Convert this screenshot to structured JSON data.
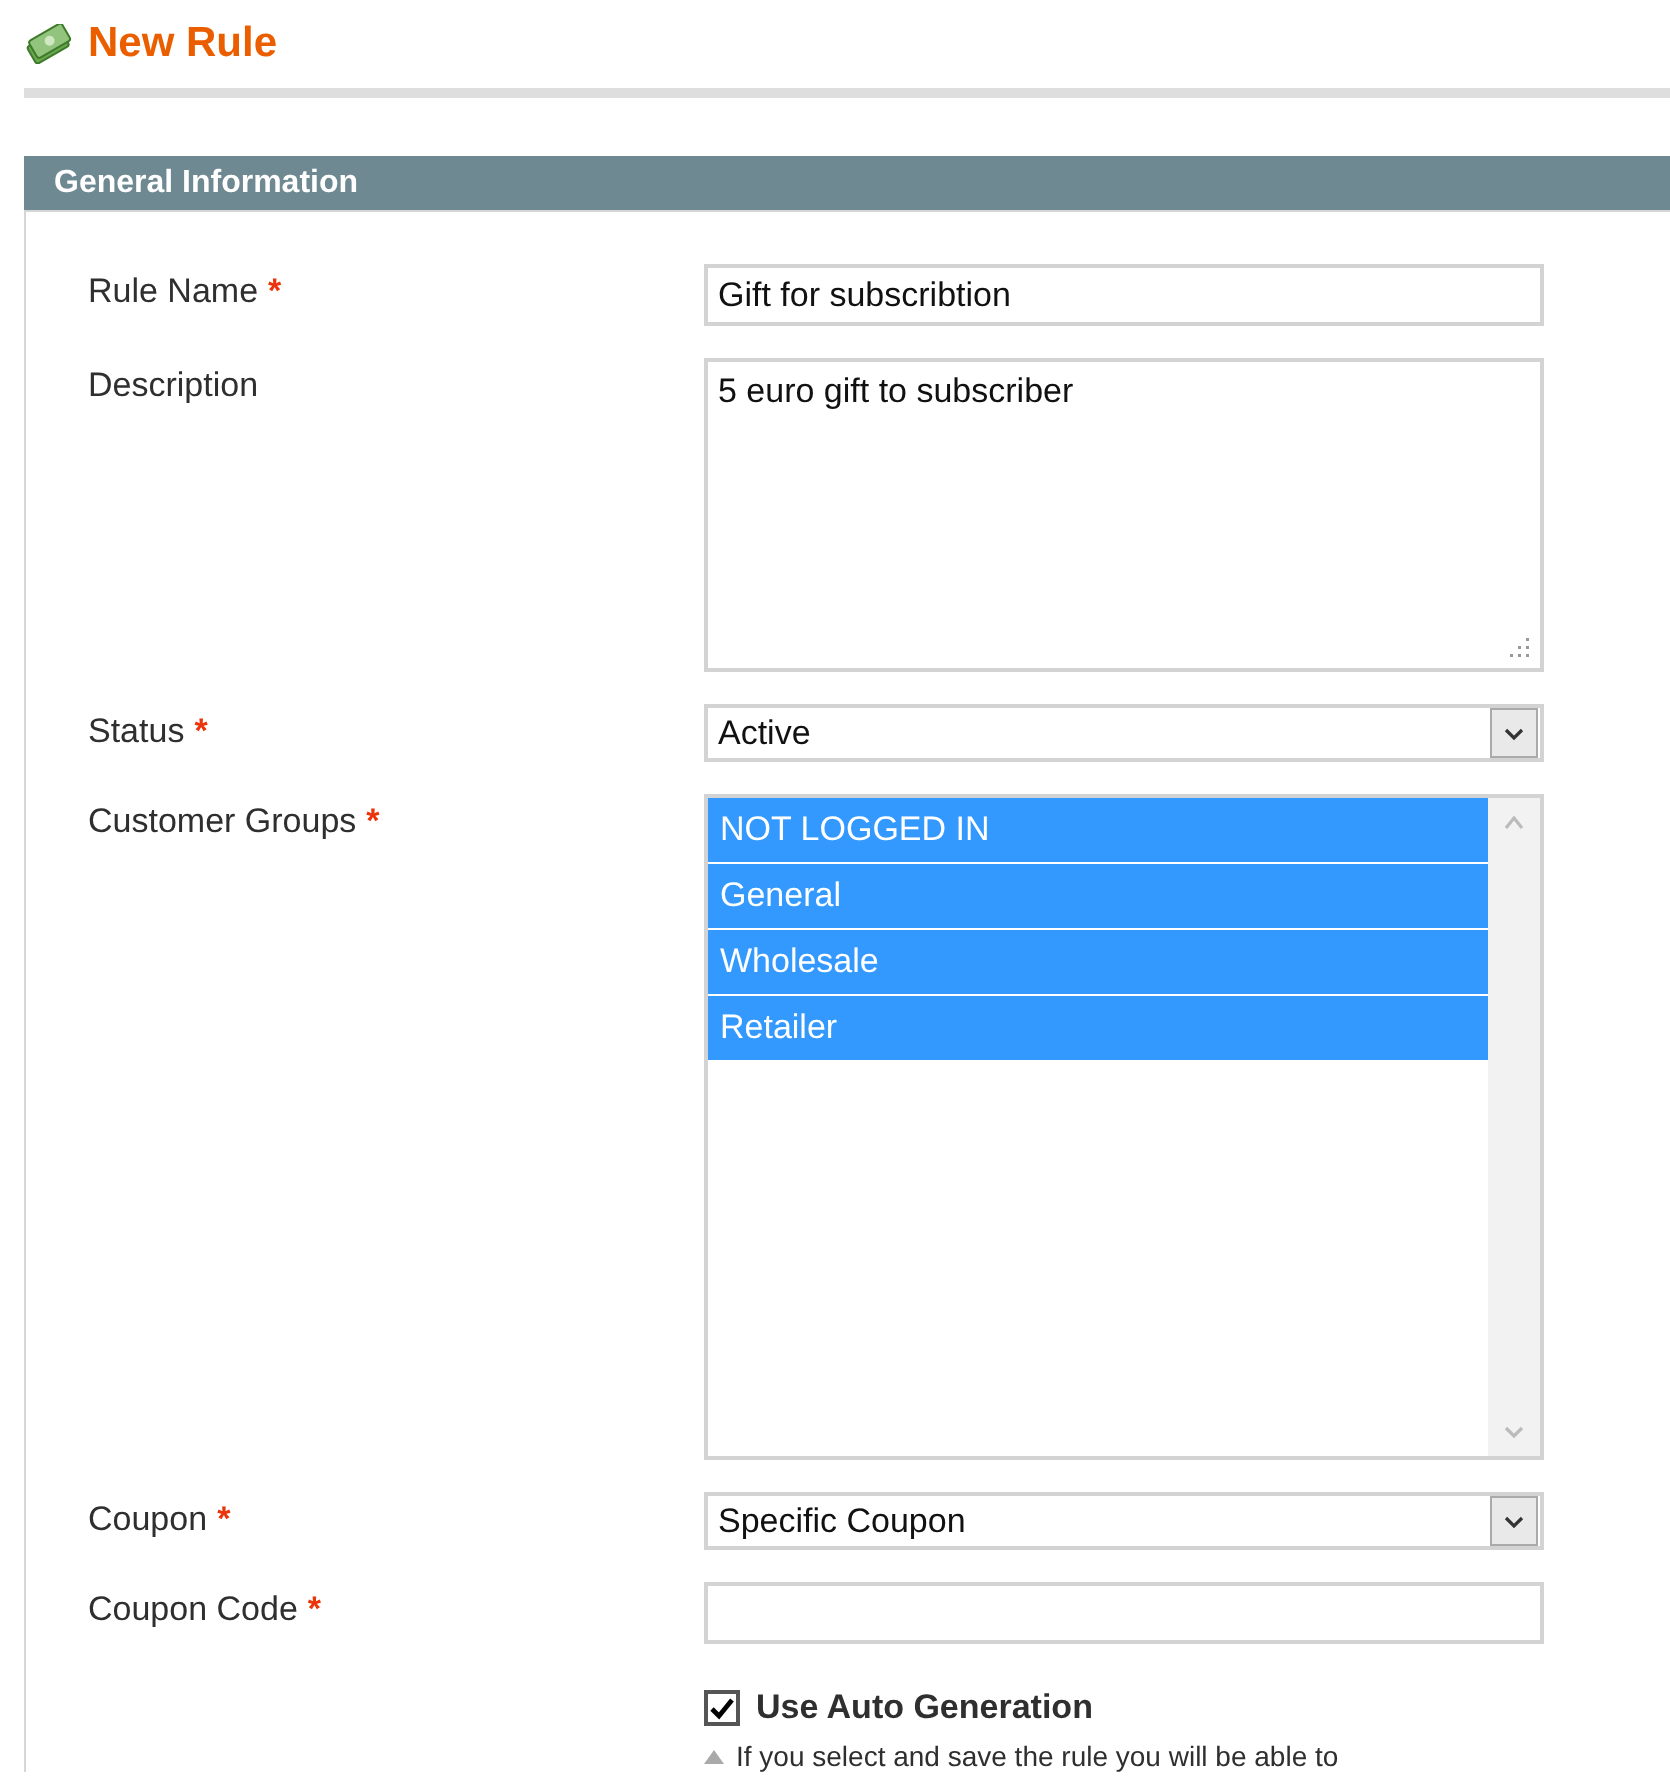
{
  "page": {
    "title": "New Rule"
  },
  "panel": {
    "title": "General Information",
    "fields": [
      {
        "kind": "text",
        "label": "Rule Name",
        "required_mark": "*",
        "value": "Gift for subscribtion"
      },
      {
        "kind": "textarea",
        "label": "Description",
        "value": "5 euro gift to subscriber"
      },
      {
        "kind": "select",
        "label": "Status",
        "required_mark": "*",
        "value": "Active"
      },
      {
        "kind": "multiselect",
        "label": "Customer Groups",
        "required_mark": "*",
        "options": [
          {
            "label": "NOT LOGGED IN",
            "selected": true
          },
          {
            "label": "General",
            "selected": true
          },
          {
            "label": "Wholesale",
            "selected": true
          },
          {
            "label": "Retailer",
            "selected": true
          }
        ]
      },
      {
        "kind": "select",
        "label": "Coupon",
        "required_mark": "*",
        "value": "Specific Coupon"
      },
      {
        "kind": "text",
        "label": "Coupon Code",
        "required_mark": "*"
      },
      {
        "kind": "checkbox",
        "label": "Use Auto Generation",
        "checked": true,
        "note": "If you select and save the rule you will be able to"
      }
    ]
  }
}
